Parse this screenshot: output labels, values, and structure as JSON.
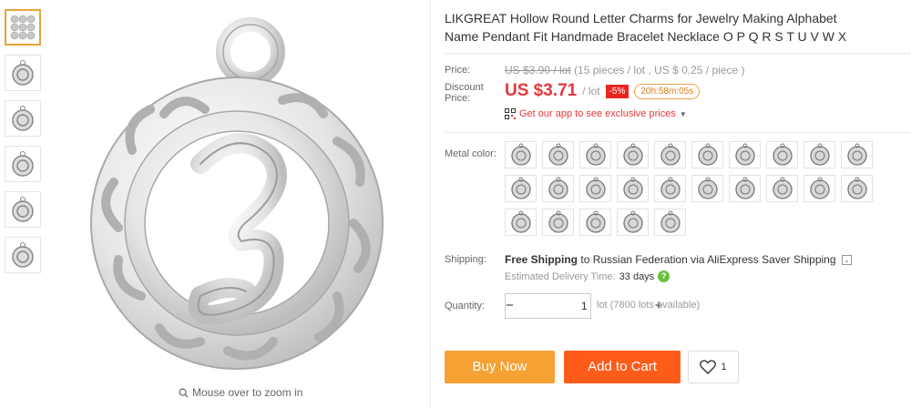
{
  "product": {
    "title": "LIKGREAT Hollow Round Letter Charms for Jewelry Making Alphabet Name Pendant Fit Handmade Bracelet Necklace O P Q R S T U V W X"
  },
  "price": {
    "label": "Price:",
    "original": "US $3.90 / lot",
    "original_note": "(15 pieces / lot , US $ 0.25 / piece )",
    "discount_label_1": "Discount",
    "discount_label_2": "Price:",
    "current": "US $3.71",
    "unit": "/ lot",
    "discount_badge": "-5%",
    "timer": "20h:58m:05s",
    "app_link": "Get our app to see exclusive prices",
    "accent_color": "#e4393c"
  },
  "metal_color": {
    "label": "Metal color:",
    "option_count_note": "25 swatches, letters A-Y style charms"
  },
  "shipping": {
    "label": "Shipping:",
    "free": "Free Shipping",
    "to": "to",
    "destination": "Russian Federation via AliExpress Saver Shipping",
    "est_label": "Estimated Delivery Time:",
    "est_days": "33 days",
    "help_icon": "question-icon"
  },
  "quantity": {
    "label": "Quantity:",
    "minus": "−",
    "plus": "+",
    "value": "1",
    "note": "lot (7800 lots available)"
  },
  "actions": {
    "buy_now": "Buy Now",
    "add_to_cart": "Add to Cart",
    "wishlist_count": "1",
    "buy_color": "#f5a134",
    "cart_color": "#ff5c1a"
  },
  "gallery": {
    "zoom_hint": "Mouse over to zoom in",
    "zoom_icon": "magnifier-icon"
  }
}
